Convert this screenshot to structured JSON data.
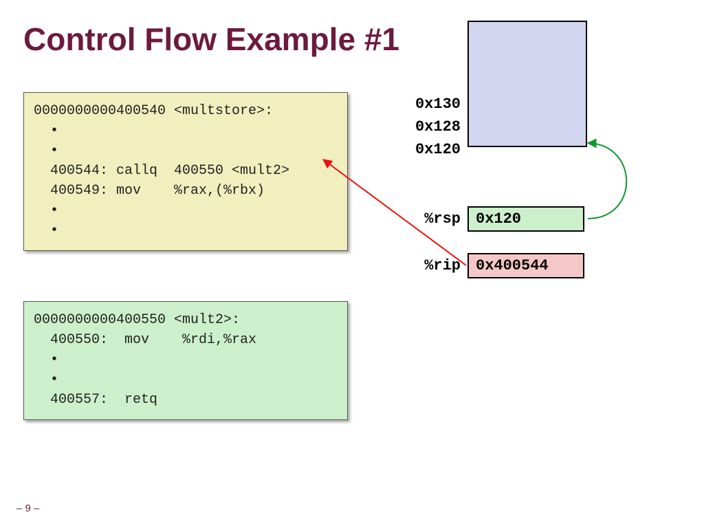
{
  "title": "Control Flow Example #1",
  "multstore_code": "0000000000400540 <multstore>:\n  •\n  •\n  400544: callq  400550 <mult2>\n  400549: mov    %rax,(%rbx)\n  •\n  •",
  "mult2_code": "0000000000400550 <mult2>:\n  400550:  mov    %rdi,%rax\n  •\n  •\n  400557:  retq",
  "stack": {
    "addr1": "0x130",
    "addr2": "0x128",
    "addr3": "0x120"
  },
  "registers": {
    "rsp_label": "%rsp",
    "rsp_value": "0x120",
    "rip_label": "%rip",
    "rip_value": "0x400544"
  },
  "page": "– 9 –"
}
